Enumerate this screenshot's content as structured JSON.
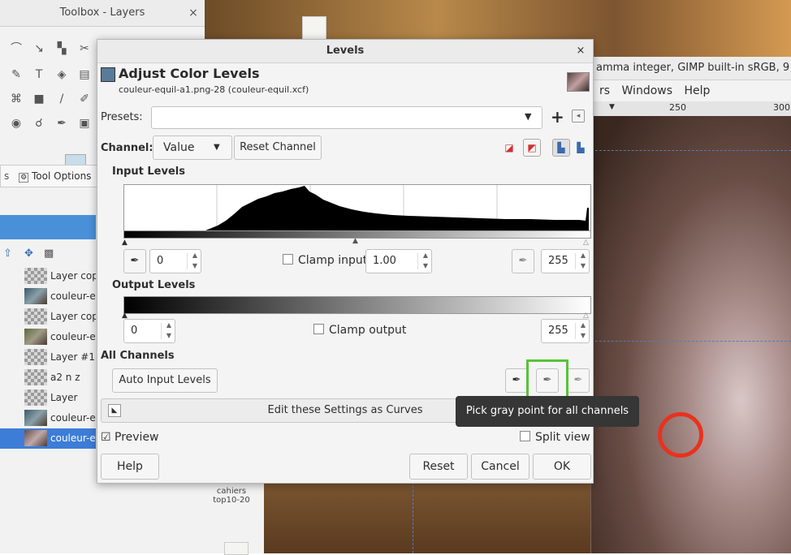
{
  "toolbox": {
    "title": "Toolbox - Layers",
    "close_glyph": "×",
    "tool_options_tab": "Tool Options",
    "tab_prefix": "s"
  },
  "layers": [
    {
      "name": "Layer copy",
      "thumb": "checker"
    },
    {
      "name": "couleur-equil",
      "thumb": "photo"
    },
    {
      "name": "Layer copy",
      "thumb": "checker"
    },
    {
      "name": "couleur-equil",
      "thumb": "photo2"
    },
    {
      "name": "Layer #1",
      "thumb": "checker"
    },
    {
      "name": "a2 n z",
      "thumb": "checker"
    },
    {
      "name": "Layer",
      "thumb": "checker"
    },
    {
      "name": "couleur-equil",
      "thumb": "photo"
    },
    {
      "name": "couleur-equil",
      "thumb": "photo3",
      "selected": true
    }
  ],
  "gimp_window": {
    "title_fragment": "amma integer, GIMP built-in sRGB, 9",
    "menu": [
      "rs",
      "Windows",
      "Help"
    ],
    "ruler_labels": [
      "250",
      "300"
    ]
  },
  "desktop": {
    "folder_label_1": "cahiers",
    "folder_label_2": "top10-20"
  },
  "dialog": {
    "window_title": "Levels",
    "close_glyph": "×",
    "header_title": "Adjust Color Levels",
    "header_subtitle": "couleur-equil-a1.png-28 (couleur-equil.xcf)",
    "presets_label": "Presets:",
    "presets_value": "",
    "channel_label": "Channel:",
    "channel_value": "Value",
    "reset_channel": "Reset Channel",
    "input_levels_label": "Input Levels",
    "input_low": "0",
    "clamp_input_label": "Clamp input",
    "gamma": "1.00",
    "input_high": "255",
    "output_levels_label": "Output Levels",
    "output_low": "0",
    "clamp_output_label": "Clamp output",
    "output_high": "255",
    "all_channels_label": "All Channels",
    "auto_input_levels": "Auto Input Levels",
    "edit_as_curves": "Edit these Settings as Curves",
    "preview_label": "Preview",
    "preview_checked": true,
    "split_view_label": "Split view",
    "help": "Help",
    "reset": "Reset",
    "cancel": "Cancel",
    "ok": "OK"
  },
  "tooltip": "Pick gray point for all channels",
  "colors": {
    "accent": "#3d7dd8",
    "highlight": "#58c23a",
    "annotation": "#e8321e"
  }
}
